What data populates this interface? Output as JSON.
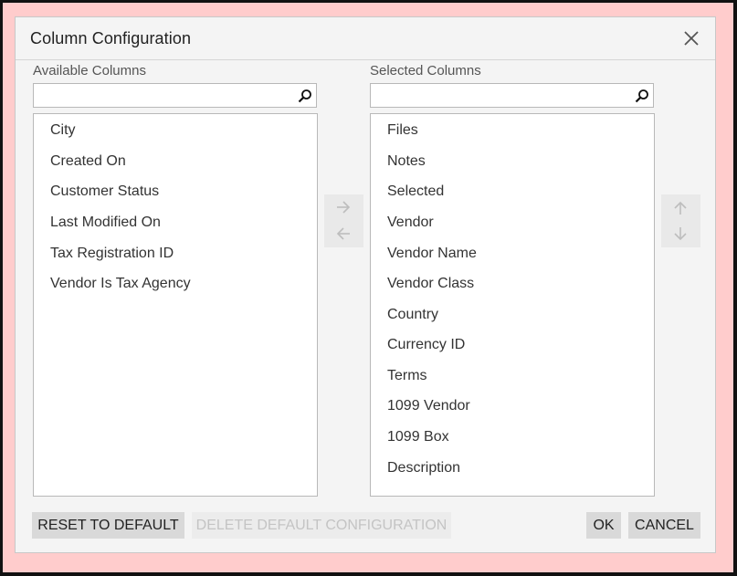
{
  "dialog": {
    "title": "Column Configuration",
    "close_icon": "close-icon"
  },
  "available": {
    "label": "Available Columns",
    "search_value": "",
    "search_icon": "search-icon",
    "items": [
      "City",
      "Created On",
      "Customer Status",
      "Last Modified On",
      "Tax Registration ID",
      "Vendor Is Tax Agency"
    ]
  },
  "selected": {
    "label": "Selected Columns",
    "search_value": "",
    "search_icon": "search-icon",
    "items": [
      "Files",
      "Notes",
      "Selected",
      "Vendor",
      "Vendor Name",
      "Vendor Class",
      "Country",
      "Currency ID",
      "Terms",
      "1099 Vendor",
      "1099 Box",
      "Description"
    ]
  },
  "transfer": {
    "add_icon": "arrow-right-icon",
    "remove_icon": "arrow-left-icon"
  },
  "order": {
    "up_icon": "arrow-up-icon",
    "down_icon": "arrow-down-icon"
  },
  "footer": {
    "reset_label": "RESET TO DEFAULT",
    "delete_label": "DELETE DEFAULT CONFIGURATION",
    "ok_label": "OK",
    "cancel_label": "CANCEL"
  },
  "colors": {
    "dialog_bg": "#f4f4f4",
    "backdrop": "#ffcccc",
    "button_bg": "#d9d9d9",
    "disabled_text": "#c4c4c4"
  }
}
